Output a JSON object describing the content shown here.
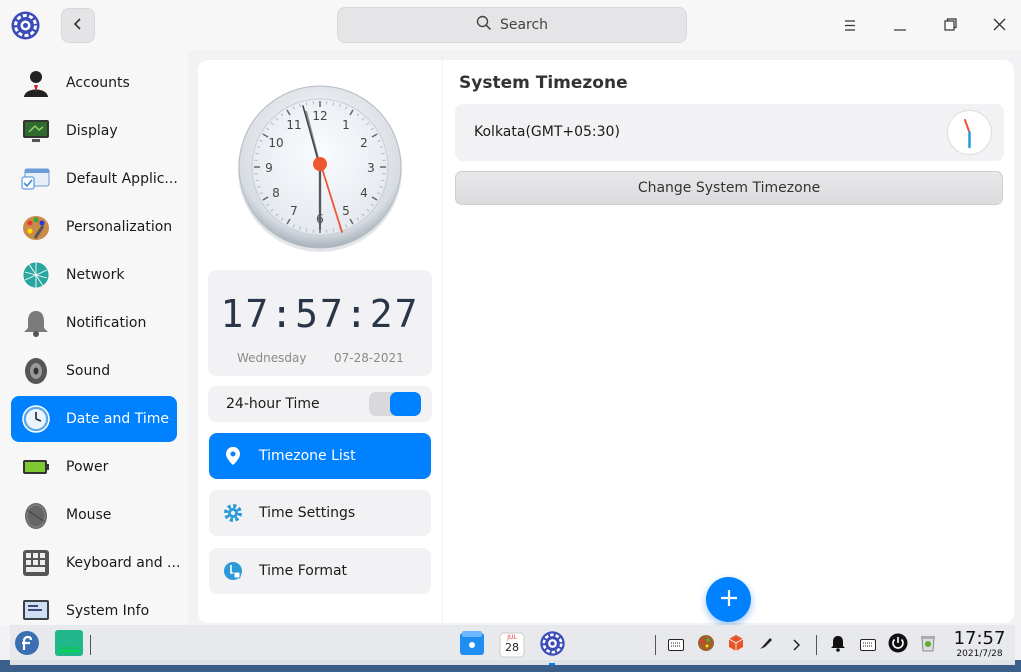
{
  "titlebar": {
    "search_label": "Search",
    "icons": [
      "app-settings-logo",
      "back-icon",
      "search-icon",
      "menu-icon",
      "minimize-icon",
      "maximize-icon",
      "close-icon"
    ]
  },
  "sidebar": {
    "items": [
      {
        "label": "Accounts",
        "icon": "accounts-icon"
      },
      {
        "label": "Display",
        "icon": "display-icon"
      },
      {
        "label": "Default Applic...",
        "icon": "default-apps-icon"
      },
      {
        "label": "Personalization",
        "icon": "personalization-icon"
      },
      {
        "label": "Network",
        "icon": "network-icon"
      },
      {
        "label": "Notification",
        "icon": "notification-icon"
      },
      {
        "label": "Sound",
        "icon": "sound-icon"
      },
      {
        "label": "Date and Time",
        "icon": "clock-icon",
        "active": true
      },
      {
        "label": "Power",
        "icon": "battery-icon"
      },
      {
        "label": "Mouse",
        "icon": "mouse-icon"
      },
      {
        "label": "Keyboard and ...",
        "icon": "keyboard-icon"
      },
      {
        "label": "System Info",
        "icon": "system-info-icon"
      }
    ]
  },
  "clock": {
    "numbers": [
      "12",
      "1",
      "2",
      "3",
      "4",
      "5",
      "6",
      "7",
      "8",
      "9",
      "10",
      "11"
    ],
    "time": "17:57:27",
    "weekday": "Wednesday",
    "date": "07-28-2021"
  },
  "settings": {
    "hour24_label": "24-hour Time",
    "hour24_enabled": true,
    "menu": [
      {
        "label": "Timezone List",
        "icon": "location-pin-icon",
        "active": true
      },
      {
        "label": "Time Settings",
        "icon": "gear-icon"
      },
      {
        "label": "Time Format",
        "icon": "time-format-icon"
      }
    ]
  },
  "timezone": {
    "title": "System Timezone",
    "current": "Kolkata(GMT+05:30)",
    "change_label": "Change System Timezone"
  },
  "dock": {
    "calendar_month": "JUL",
    "calendar_day": "28",
    "clock_time": "17:57",
    "clock_date": "2021/7/28"
  },
  "colors": {
    "accent": "#0081ff",
    "second_hand": "#ee5533"
  }
}
